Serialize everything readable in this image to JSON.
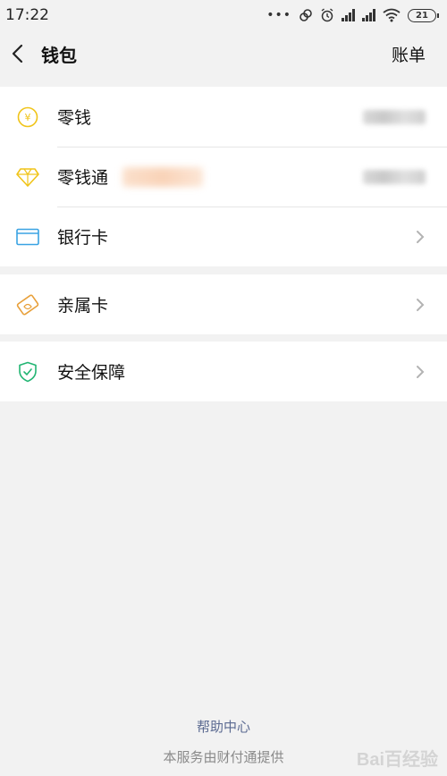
{
  "status": {
    "time": "17:22",
    "dots": "•••",
    "battery": "21"
  },
  "header": {
    "title": "钱包",
    "bill": "账单"
  },
  "groups": [
    {
      "items": [
        {
          "label": "零钱",
          "icon": "yuan-coin-icon"
        },
        {
          "label": "零钱通",
          "icon": "diamond-icon"
        },
        {
          "label": "银行卡",
          "icon": "bank-card-icon"
        }
      ]
    },
    {
      "items": [
        {
          "label": "亲属卡",
          "icon": "family-card-icon"
        }
      ]
    },
    {
      "items": [
        {
          "label": "安全保障",
          "icon": "shield-check-icon"
        }
      ]
    }
  ],
  "footer": {
    "help": "帮助中心",
    "note": "本服务由财付通提供"
  },
  "watermark": "Bai百经验",
  "colors": {
    "yellow": "#f0c419",
    "blue": "#3aa3e3",
    "orange": "#e8a03a",
    "green": "#22b573",
    "link": "#5b6a91"
  }
}
